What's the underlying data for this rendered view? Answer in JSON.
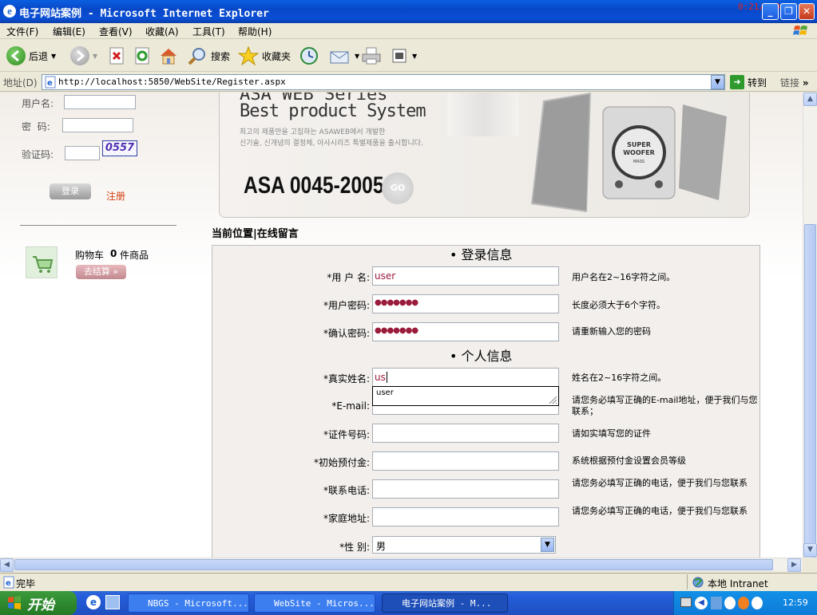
{
  "window": {
    "title": "电子网站案例 - Microsoft Internet Explorer",
    "overlay_text": "0:21/3:00"
  },
  "menu": [
    "文件(F)",
    "编辑(E)",
    "查看(V)",
    "收藏(A)",
    "工具(T)",
    "帮助(H)"
  ],
  "toolbar": {
    "back": "后退",
    "search": "搜索",
    "favorites": "收藏夹"
  },
  "address": {
    "label": "地址(D)",
    "url": "http://localhost:5850/WebSite/Register.aspx",
    "go": "转到",
    "links": "链接"
  },
  "login": {
    "username_label": "用户名:",
    "password_label": "密  码:",
    "captcha_label": "验证码:",
    "captcha_code": "0557",
    "login_button": "登录",
    "register_link": "注册"
  },
  "cart": {
    "label": "购物车",
    "count": "0",
    "unit": "件商品",
    "checkout": "去结算 »"
  },
  "banner": {
    "headline_top": "ASA WEB Series",
    "headline": "Best product System",
    "korean_line1": "최고의 제품만을 고집하는 ASAWEB에서 개발한",
    "korean_line2": "신기술, 신개념의 결정체, 아사시리즈 특별제품을 출시합니다.",
    "model": "ASA 0045-2005",
    "go": "GO",
    "speaker_line1": "SUPER",
    "speaker_line2": "WOOFER",
    "speaker_line3": "MASS"
  },
  "breadcrumb": "当前位置|在线留言",
  "form": {
    "section_login": "• 登录信息",
    "section_personal": "• 个人信息",
    "fields": [
      {
        "label": "*用 户 名:",
        "value": "user",
        "hint": "用户名在2~16字符之间。"
      },
      {
        "label": "*用户密码:",
        "value": "●●●●●●●",
        "hint": "长度必须大于6个字符。"
      },
      {
        "label": "*确认密码:",
        "value": "●●●●●●●",
        "hint": "请重新输入您的密码"
      },
      {
        "label": "*真实姓名:",
        "value": "us",
        "hint": "姓名在2~16字符之间。"
      },
      {
        "label": "*E-mail:",
        "value": "",
        "hint": "请您务必填写正确的E-mail地址，便于我们与您联系；"
      },
      {
        "label": "*证件号码:",
        "value": "",
        "hint": "请如实填写您的证件"
      },
      {
        "label": "*初始预付金:",
        "value": "",
        "hint": "系统根据预付金设置会员等级"
      },
      {
        "label": "*联系电话:",
        "value": "",
        "hint": "请您务必填写正确的电话，便于我们与您联系"
      },
      {
        "label": "*家庭地址:",
        "value": "",
        "hint": "请您务必填写正确的电话，便于我们与您联系"
      },
      {
        "label": "*性  别:",
        "value": "男",
        "hint": ""
      }
    ],
    "autocomplete_suggestion": "user"
  },
  "status": {
    "text": "完毕",
    "zone": "本地 Intranet"
  },
  "taskbar": {
    "start": "开始",
    "tasks": [
      "NBGS - Microsoft...",
      "WebSite - Micros...",
      "电子网站案例 - M..."
    ],
    "clock": "12:59"
  },
  "colors": {
    "title_blue": "#0a4fd6",
    "taskbar_blue": "#245edc",
    "start_green": "#2f8a2f",
    "password_dot": "#9b1b3c",
    "link_red": "#d04010"
  }
}
